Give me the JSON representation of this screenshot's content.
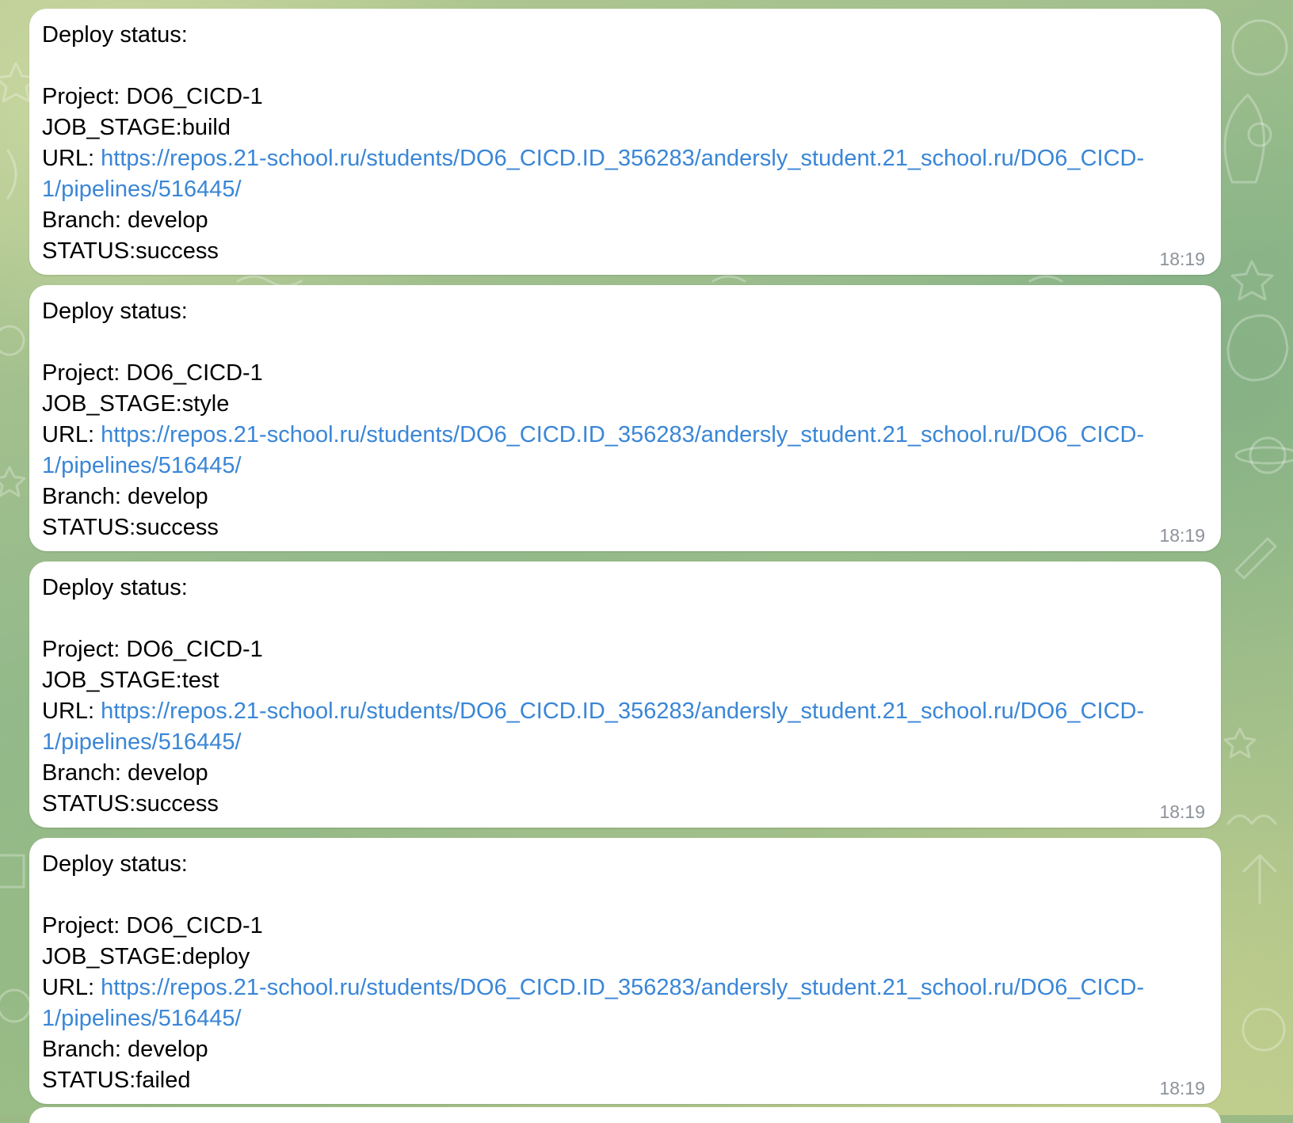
{
  "messages": [
    {
      "title": "Deploy status:",
      "project_label": "Project: ",
      "project": "DO6_CICD-1",
      "stage_label": "JOB_STAGE:",
      "stage": "build",
      "url_label": "URL: ",
      "url_line1": "https://repos.21-school.ru/students/DO6_CICD.ID_356283/andersly_student.21_school.ru/DO6_CICD-",
      "url_line2": "1/pipelines/516445/",
      "branch_label": "Branch: ",
      "branch": "develop",
      "status_label": "STATUS:",
      "status": "success",
      "time": "18:19"
    },
    {
      "title": "Deploy status:",
      "project_label": "Project: ",
      "project": "DO6_CICD-1",
      "stage_label": "JOB_STAGE:",
      "stage": "style",
      "url_label": "URL: ",
      "url_line1": "https://repos.21-school.ru/students/DO6_CICD.ID_356283/andersly_student.21_school.ru/DO6_CICD-",
      "url_line2": "1/pipelines/516445/",
      "branch_label": "Branch: ",
      "branch": "develop",
      "status_label": "STATUS:",
      "status": "success",
      "time": "18:19"
    },
    {
      "title": "Deploy status:",
      "project_label": "Project: ",
      "project": "DO6_CICD-1",
      "stage_label": "JOB_STAGE:",
      "stage": "test",
      "url_label": "URL: ",
      "url_line1": "https://repos.21-school.ru/students/DO6_CICD.ID_356283/andersly_student.21_school.ru/DO6_CICD-",
      "url_line2": "1/pipelines/516445/",
      "branch_label": "Branch: ",
      "branch": "develop",
      "status_label": "STATUS:",
      "status": "success",
      "time": "18:19"
    },
    {
      "title": "Deploy status:",
      "project_label": "Project: ",
      "project": "DO6_CICD-1",
      "stage_label": "JOB_STAGE:",
      "stage": "deploy",
      "url_label": "URL: ",
      "url_line1": "https://repos.21-school.ru/students/DO6_CICD.ID_356283/andersly_student.21_school.ru/DO6_CICD-",
      "url_line2": "1/pipelines/516445/",
      "branch_label": "Branch: ",
      "branch": "develop",
      "status_label": "STATUS:",
      "status": "failed",
      "time": "18:19"
    }
  ],
  "theme": {
    "link_color": "#3a86d6",
    "bubble_color": "#ffffff",
    "time_color": "#8d939a",
    "wallpaper_green": "#9ab985"
  }
}
